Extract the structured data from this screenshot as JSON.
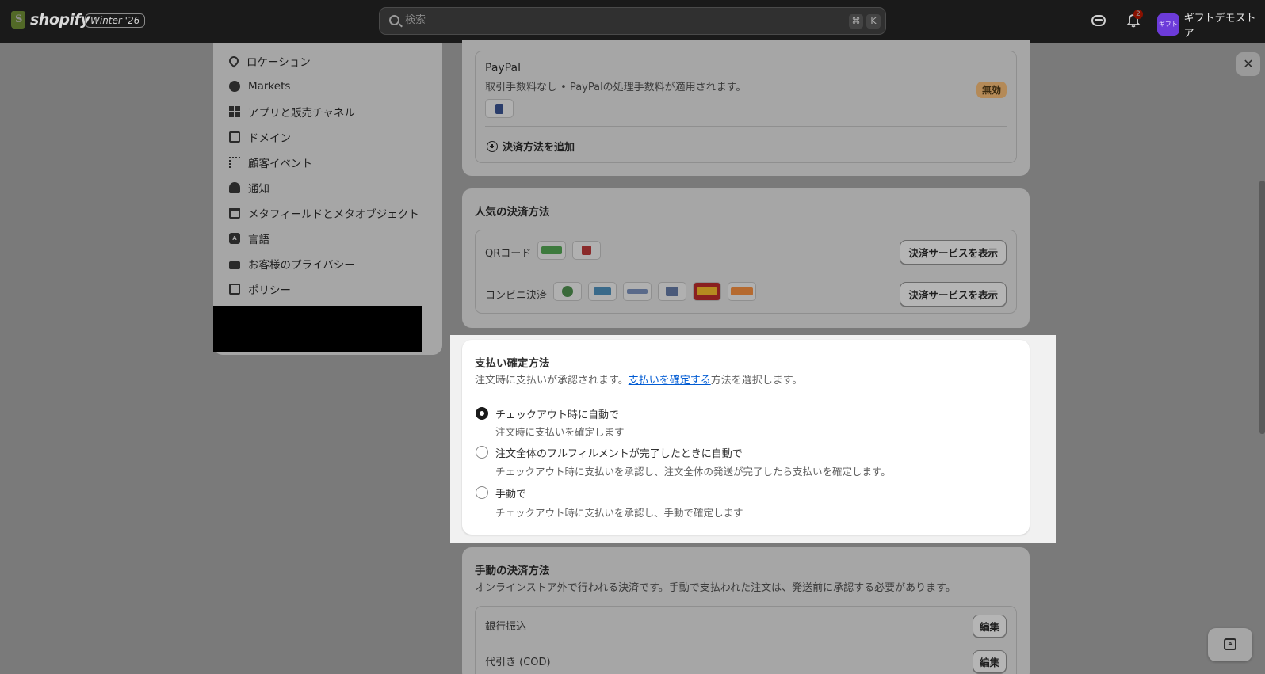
{
  "topbar": {
    "brand": "shopify",
    "edition": "Winter '26",
    "search_placeholder": "検索",
    "shortcut_cmd": "⌘",
    "shortcut_key": "K",
    "notification_count": "2",
    "avatar_text": "ギフト",
    "store_name": "ギフトデモストア"
  },
  "sidebar": {
    "items": [
      {
        "label": "ロケーション",
        "icon": "location-pin-icon"
      },
      {
        "label": "Markets",
        "icon": "globe-icon"
      },
      {
        "label": "アプリと販売チャネル",
        "icon": "apps-icon"
      },
      {
        "label": "ドメイン",
        "icon": "domain-icon"
      },
      {
        "label": "顧客イベント",
        "icon": "cursor-click-icon"
      },
      {
        "label": "通知",
        "icon": "bell-icon"
      },
      {
        "label": "メタフィールドとメタオブジェクト",
        "icon": "metafield-icon"
      },
      {
        "label": "言語",
        "icon": "language-icon"
      },
      {
        "label": "お客様のプライバシー",
        "icon": "lock-icon"
      },
      {
        "label": "ポリシー",
        "icon": "policy-icon"
      }
    ]
  },
  "paypal": {
    "name": "PayPal",
    "description": "取引手数料なし • PayPalの処理手数料が適用されます。",
    "status": "無効",
    "add_method": "決済方法を追加"
  },
  "popular": {
    "title": "人気の決済方法",
    "rows": [
      {
        "label": "QRコード",
        "button": "決済サービスを表示"
      },
      {
        "label": "コンビニ決済",
        "button": "決済サービスを表示"
      }
    ]
  },
  "capture": {
    "title": "支払い確定方法",
    "sub_before": "注文時に支払いが承認されます。",
    "sub_link": "支払いを確定する",
    "sub_after": "方法を選択します。",
    "options": [
      {
        "label": "チェックアウト時に自動で",
        "help": "注文時に支払いを確定します",
        "checked": true
      },
      {
        "label": "注文全体のフルフィルメントが完了したときに自動で",
        "help": "チェックアウト時に支払いを承認し、注文全体の発送が完了したら支払いを確定します。",
        "checked": false
      },
      {
        "label": "手動で",
        "help": "チェックアウト時に支払いを承認し、手動で確定します",
        "checked": false
      }
    ]
  },
  "manual": {
    "title": "手動の決済方法",
    "description": "オンラインストア外で行われる決済です。手動で支払われた注文は、発送前に承認する必要があります。",
    "rows": [
      {
        "label": "銀行振込",
        "button": "編集"
      },
      {
        "label": "代引き (COD)",
        "button": "編集"
      }
    ]
  },
  "colors": {
    "accent_link": "#005bd3",
    "topbar": "#1a1a1a",
    "status_badge": "#b48a58"
  }
}
